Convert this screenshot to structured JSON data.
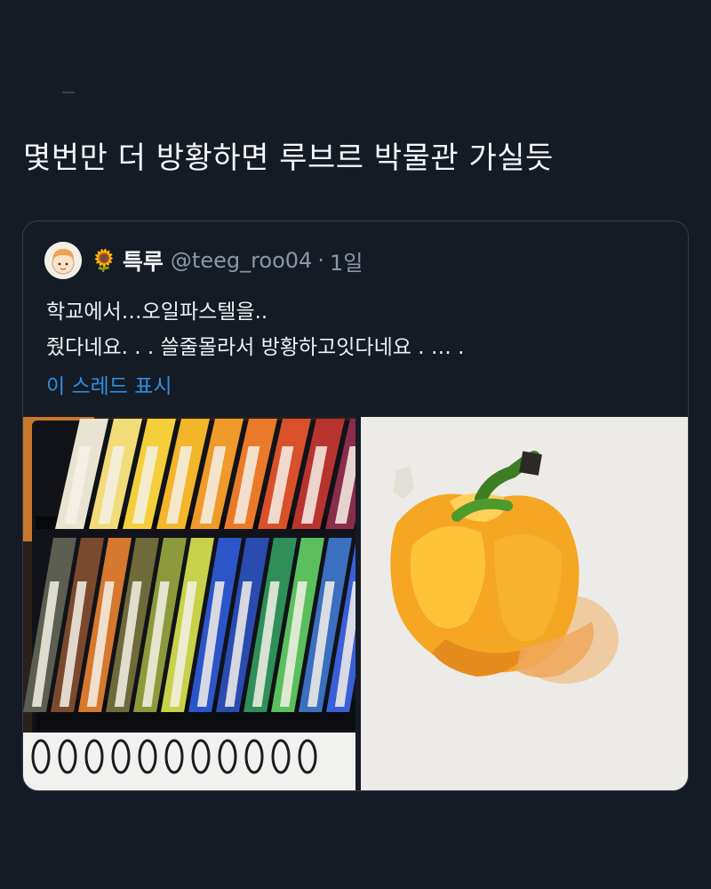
{
  "tweet": {
    "text": "몇번만 더 방황하면 루브르 박물관 가실듯"
  },
  "quoted": {
    "emoji": "🌻",
    "name": "특루",
    "handle": "@teeg_roo04",
    "dot": "·",
    "time": "1일",
    "lines": [
      "학교에서…오일파스텔을..",
      "줬다네요. . . 쓸줄몰라서 방황하고잇다네요 . … ."
    ],
    "show_thread": "이 스레드 표시"
  },
  "pastel_colors": {
    "top_row": [
      "#e9e4d2",
      "#f2dc7a",
      "#f4cf3a",
      "#f3b52a",
      "#ef9a2b",
      "#ea7a2a",
      "#d9512b",
      "#b8342f",
      "#8a2d4a"
    ],
    "bottom_row": [
      "#5c5e52",
      "#7b4a2e",
      "#d6782e",
      "#6e6a3a",
      "#8d9a3c",
      "#c7d24a",
      "#2c55c9",
      "#2a4bb0",
      "#2f8f58",
      "#5bbf5e",
      "#3b6fc0",
      "#3a5fd6"
    ]
  },
  "pepper_colors": {
    "body": "#f5a623",
    "highlight": "#ffd05a",
    "shadow": "#e07b1c",
    "stem": "#4a8f2c"
  }
}
